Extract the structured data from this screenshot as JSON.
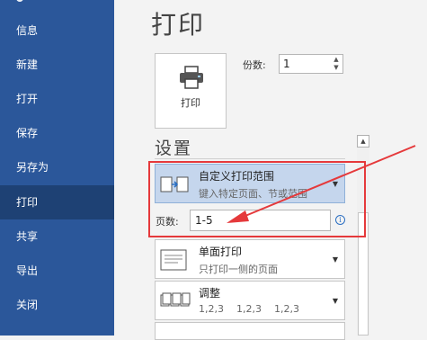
{
  "sidebar": {
    "items": [
      {
        "label": "信息"
      },
      {
        "label": "新建"
      },
      {
        "label": "打开"
      },
      {
        "label": "保存"
      },
      {
        "label": "另存为"
      },
      {
        "label": "打印"
      },
      {
        "label": "共享"
      },
      {
        "label": "导出"
      },
      {
        "label": "关闭"
      }
    ],
    "active": "打印"
  },
  "main": {
    "title": "打印",
    "print_button_label": "打印",
    "copies_label": "份数:",
    "copies_value": "1",
    "section_title": "设置",
    "range": {
      "title": "自定义打印范围",
      "subtitle": "键入特定页面、节或范围"
    },
    "pages_label": "页数:",
    "pages_value": "1-5",
    "sides": {
      "title": "单面打印",
      "subtitle": "只打印一侧的页面"
    },
    "collate": {
      "title": "调整",
      "subtitle": "1,2,3    1,2,3    1,2,3"
    }
  },
  "colors": {
    "sidebar": "#2b579a",
    "active_item": "#1e4174",
    "annotation": "#e5393b",
    "selected_dropdown": "#c5d6ed"
  }
}
